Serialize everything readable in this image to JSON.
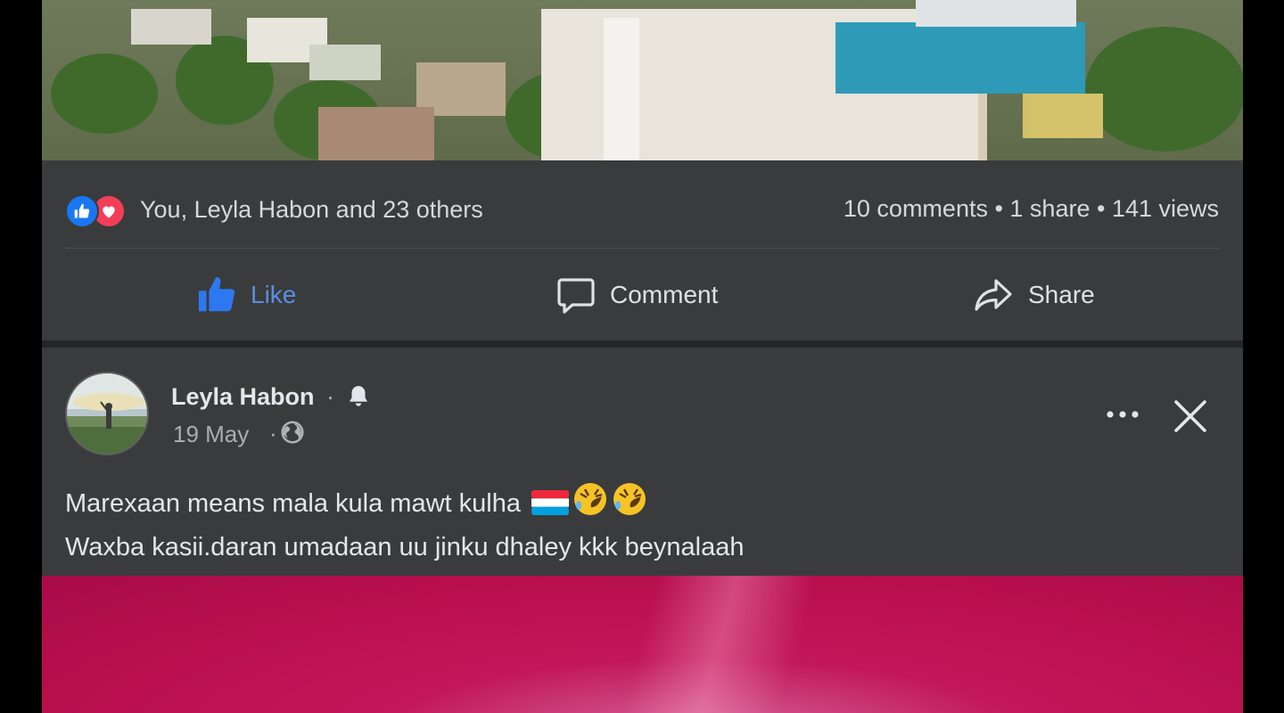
{
  "top_post": {
    "reactions": {
      "names": "You, Leyla Habon and 23 others",
      "icons": [
        "like-icon",
        "love-icon"
      ]
    },
    "counts": "10 comments • 1 share • 141 views",
    "actions": {
      "like": "Like",
      "comment": "Comment",
      "share": "Share"
    }
  },
  "post": {
    "author": "Leyla Habon",
    "name_separator": "·",
    "date": "19 May",
    "date_separator": "·",
    "text_line1": "Marexaan means mala kula mawt kulha",
    "text_line2": "Waxba kasii.daran umadaan uu jinku dhaley kkk beynalaah"
  },
  "colors": {
    "card": "#3a3b3c",
    "text": "#e4e6eb",
    "secondary_text": "#b0b3b8",
    "like_blue": "#1877f2",
    "love_red": "#f33e58",
    "media_pink": "#c2185b"
  }
}
